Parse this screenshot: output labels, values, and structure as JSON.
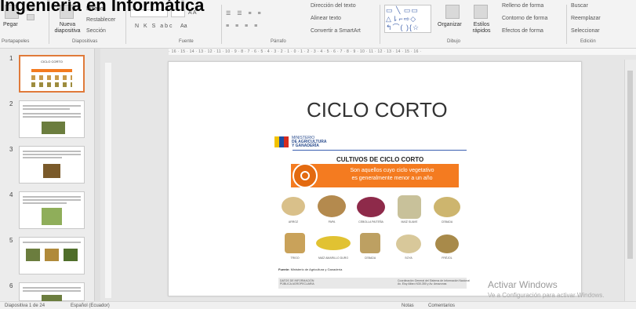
{
  "overlay": {
    "title": "Ingeniería en Informática"
  },
  "ribbon": {
    "portapapeles": {
      "pegar": "Pegar",
      "label": "Portapapeles"
    },
    "diapositivas": {
      "nueva": "Nueva diapositiva",
      "diseno": "Diseño",
      "restablecer": "Restablecer",
      "seccion": "Sección",
      "label": "Diapositivas"
    },
    "fuente": {
      "label": "Fuente",
      "font_size_glyphs": "A A",
      "format_glyphs": "N K S abc",
      "aa": "Aa"
    },
    "parrafo": {
      "label": "Párrafo",
      "direccion_texto": "Dirección del texto",
      "alinear_texto": "Alinear texto",
      "convertir_smartart": "Convertir a SmartArt"
    },
    "dibujo": {
      "label": "Dibujo",
      "organizar": "Organizar",
      "estilos_rapidos": "Estilos rápidos",
      "relleno": "Relleno de forma",
      "contorno": "Contorno de forma",
      "efectos": "Efectos de forma"
    },
    "edicion": {
      "label": "Edición",
      "buscar": "Buscar",
      "reemplazar": "Reemplazar",
      "seleccionar": "Seleccionar"
    }
  },
  "ruler": {
    "marks": "· 16 · 15 · 14 · 13 · 12 · 11 · 10 · 9 · 8 · 7 · 6 · 5 · 4 · 3 · 2 · 1 · 0 · 1 · 2 · 3 · 4 · 5 · 6 · 7 · 8 · 9 · 10 · 11 · 12 · 13 · 14 · 15 · 16 ·"
  },
  "thumbnails": {
    "numbers": [
      "1",
      "2",
      "3",
      "4",
      "5",
      "6"
    ],
    "slide1_title": "CICLO CORTO"
  },
  "slide": {
    "title": "CICLO CORTO",
    "ministry": {
      "line1": "MINISTERIO",
      "line2": "DE AGRICULTURA",
      "line3": "Y GANADERÍA"
    },
    "cultivos_title": "CULTIVOS DE CICLO CORTO",
    "banner_line1": "Son aquellos cuyo ciclo vegetativo",
    "banner_line2": "es generalmente menor a un año",
    "foods_row1": [
      "ARROZ",
      "PAPA",
      "CEBOLLA PAITEÑA",
      "MAÍZ SUAVE",
      "CEBADA"
    ],
    "foods_row2": [
      "TRIGO",
      "MAÍZ AMARILLO DURO",
      "CEBADA",
      "SOYA",
      "FRÉJOL"
    ],
    "fuente_label": "Fuente:",
    "fuente_text": "Ministerio de Agricultura y Ganadería",
    "footer_left_1": "DATOS DE INFORMACIÓN",
    "footer_left_2": "PÚBLICA AGROPECUARIA",
    "footer_right_1": "Coordinación General del Sistema de Información Nacional",
    "footer_right_2": "Av. Eloy Alfaro N30-350 y Av. Amazonas"
  },
  "watermark": {
    "line1": "Activar Windows",
    "line2": "Ve a Configuración para activar Windows."
  },
  "statusbar": {
    "left": "Diapositiva 1 de 24",
    "lang": "Español (Ecuador)",
    "notes": "Notas",
    "comments": "Comentarios"
  },
  "colors": {
    "accent": "#f47b20",
    "selected_thumb": "#e07a3a",
    "ministry_blue": "#1e4fa3"
  },
  "icons": [
    "paste-icon",
    "new-slide-icon",
    "shapes-icon",
    "arrange-icon",
    "find-icon",
    "replace-icon",
    "select-icon"
  ]
}
